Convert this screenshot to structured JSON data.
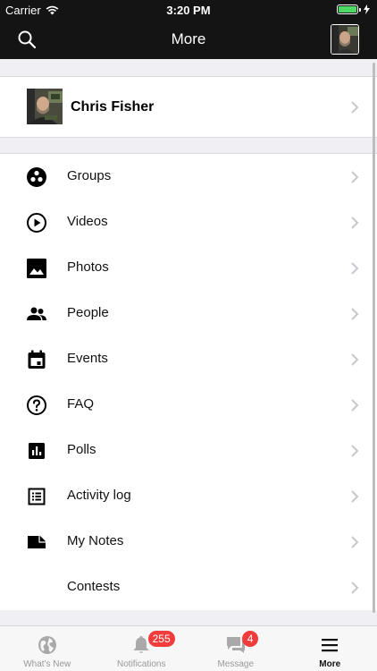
{
  "status_bar": {
    "carrier": "Carrier",
    "time": "3:20 PM"
  },
  "nav": {
    "title": "More"
  },
  "profile": {
    "name": "Chris Fisher"
  },
  "menu": {
    "items": [
      {
        "label": "Groups",
        "icon": "groups-icon"
      },
      {
        "label": "Videos",
        "icon": "play-circle-icon"
      },
      {
        "label": "Photos",
        "icon": "photo-icon"
      },
      {
        "label": "People",
        "icon": "people-icon"
      },
      {
        "label": "Events",
        "icon": "calendar-icon"
      },
      {
        "label": "FAQ",
        "icon": "help-circle-icon"
      },
      {
        "label": "Polls",
        "icon": "poll-icon"
      },
      {
        "label": "Activity log",
        "icon": "list-icon"
      },
      {
        "label": "My Notes",
        "icon": "note-icon"
      },
      {
        "label": "Contests",
        "icon": ""
      }
    ]
  },
  "tabs": {
    "whats_new": "What's New",
    "notifications": "Notifications",
    "notifications_badge": "255",
    "message": "Message",
    "message_badge": "4",
    "more": "More"
  },
  "colors": {
    "bar": "#141414",
    "badge": "#f23b3b",
    "battery": "#4cd964"
  }
}
